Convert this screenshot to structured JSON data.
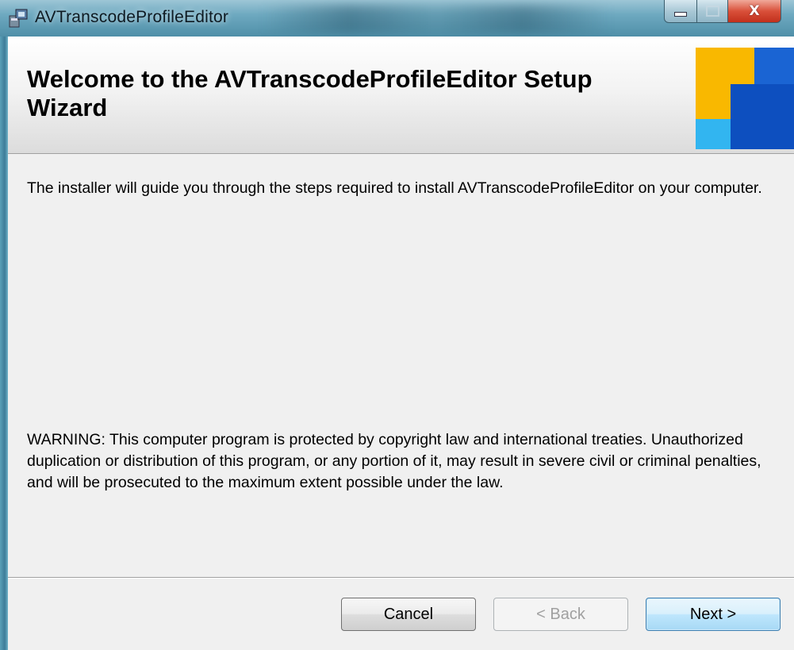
{
  "window": {
    "title": "AVTranscodeProfileEditor",
    "caption": {
      "minimize": "minimize",
      "maximize": "maximize",
      "close": "X"
    }
  },
  "header": {
    "heading": "Welcome to the AVTranscodeProfileEditor Setup Wizard",
    "logo_icon": "installer-logo-icon",
    "logo_colors": [
      "#f9b800",
      "#1a64d3",
      "#0d4fbf",
      "#32b5f0"
    ]
  },
  "body": {
    "intro": "The installer will guide you through the steps required to install AVTranscodeProfileEditor on your computer.",
    "warning": "WARNING: This computer program is protected by copyright law and international treaties. Unauthorized duplication or distribution of this program, or any portion of it, may result in severe civil or criminal penalties, and will be prosecuted to the maximum extent possible under the law."
  },
  "buttons": {
    "cancel": "Cancel",
    "back": "< Back",
    "next": "Next >"
  }
}
